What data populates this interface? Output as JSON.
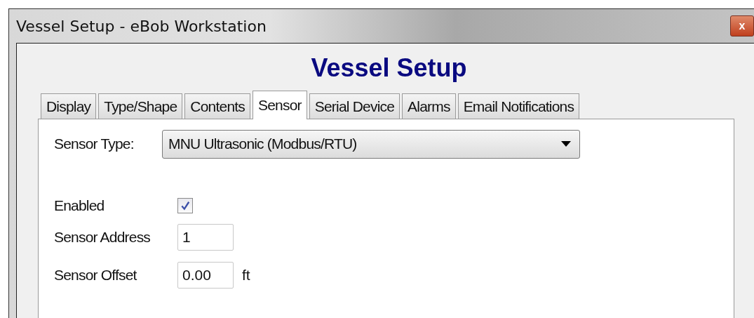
{
  "window": {
    "title": "Vessel Setup - eBob Workstation",
    "close": "x"
  },
  "heading": "Vessel Setup",
  "tabs": [
    {
      "label": "Display",
      "selected": false
    },
    {
      "label": "Type/Shape",
      "selected": false
    },
    {
      "label": "Contents",
      "selected": false
    },
    {
      "label": "Sensor",
      "selected": true
    },
    {
      "label": "Serial Device",
      "selected": false
    },
    {
      "label": "Alarms",
      "selected": false
    },
    {
      "label": "Email Notifications",
      "selected": false
    }
  ],
  "sensor_type": {
    "label": "Sensor Type:",
    "value": "MNU Ultrasonic (Modbus/RTU)"
  },
  "enabled": {
    "label": "Enabled",
    "checked": true
  },
  "sensor_address": {
    "label": "Sensor Address",
    "value": "1"
  },
  "sensor_offset": {
    "label": "Sensor Offset",
    "value": "0.00",
    "unit": "ft"
  }
}
